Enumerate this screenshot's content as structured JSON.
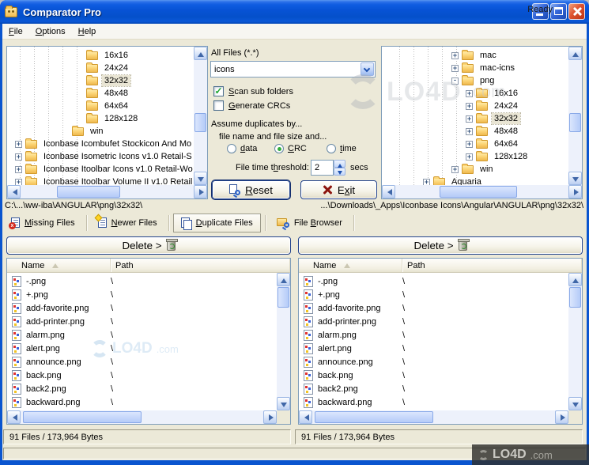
{
  "window": {
    "title": "Comparator Pro"
  },
  "colors": {
    "titlebar_blue": "#0752d4",
    "client_beige": "#ece9d8",
    "panel_border": "#7f9db9",
    "close_red": "#dd5330",
    "folder_yellow": "#fcd575",
    "check_green": "#1ba52f"
  },
  "menu": {
    "items": [
      {
        "pre": "",
        "key": "F",
        "post": "ile"
      },
      {
        "pre": "",
        "key": "O",
        "post": "ptions"
      },
      {
        "pre": "",
        "key": "H",
        "post": "elp"
      }
    ]
  },
  "filter": {
    "label": "All Files (*.*)",
    "value": "icons"
  },
  "options": {
    "scan_sub_folders": {
      "pre": "",
      "key": "S",
      "post": "can sub folders",
      "checked": true
    },
    "generate_crcs": {
      "pre": "",
      "key": "G",
      "post": "enerate CRCs",
      "checked": false
    }
  },
  "duplicates": {
    "heading": "Assume duplicates by...",
    "subheading": "file name and file size and...",
    "radio_data": {
      "pre": "",
      "key": "d",
      "post": "ata"
    },
    "radio_crc": {
      "pre": "",
      "key": "C",
      "post": "RC"
    },
    "radio_time": {
      "pre": "",
      "key": "t",
      "post": "ime"
    },
    "selected_radio": "CRC",
    "threshold": {
      "pre": "File time t",
      "key": "h",
      "post": "reshold:",
      "value": "2",
      "unit": "secs"
    }
  },
  "buttons": {
    "reset": {
      "pre": "",
      "key": "R",
      "post": "eset"
    },
    "exit": {
      "pre": "E",
      "key": "x",
      "post": "it"
    },
    "delete_left": "Delete >",
    "delete_right": "Delete >"
  },
  "left_tree": {
    "items": [
      {
        "label": "16x16"
      },
      {
        "label": "24x24"
      },
      {
        "label": "32x32",
        "selected": true
      },
      {
        "label": "48x48"
      },
      {
        "label": "64x64"
      },
      {
        "label": "128x128"
      },
      {
        "label": "win"
      },
      {
        "label": "Iconbase Icombufet Stockicon And Mo"
      },
      {
        "label": "Iconbase Isometric Icons v1.0 Retail-S"
      },
      {
        "label": "Iconbase Itoolbar Icons v1.0 Retail-Wo"
      },
      {
        "label": "Iconbase Itoolbar Volume II v1.0 Retail"
      }
    ]
  },
  "right_tree": {
    "items": [
      {
        "label": "mac"
      },
      {
        "label": "mac-icns"
      },
      {
        "label": "png"
      },
      {
        "label": "16x16"
      },
      {
        "label": "24x24"
      },
      {
        "label": "32x32",
        "selected": true
      },
      {
        "label": "48x48"
      },
      {
        "label": "64x64"
      },
      {
        "label": "128x128"
      },
      {
        "label": "win"
      },
      {
        "label": "Aquaria"
      }
    ]
  },
  "paths": {
    "left": "C:\\...\\ww-iba\\ANGULAR\\png\\32x32\\",
    "right": "...\\Downloads\\_Apps\\Iconbase Icons\\Angular\\ANGULAR\\png\\32x32\\"
  },
  "tabs": {
    "missing": {
      "pre": "",
      "key": "M",
      "post": "issing Files"
    },
    "newer": {
      "pre": "",
      "key": "N",
      "post": "ewer Files"
    },
    "duplicate": {
      "pre": "",
      "key": "D",
      "post": "uplicate Files",
      "selected": true
    },
    "browser": {
      "pre": "File ",
      "key": "B",
      "post": "rowser"
    }
  },
  "lists": {
    "columns": {
      "name": "Name",
      "path": "Path"
    },
    "rows": [
      {
        "name": "-.png",
        "path": "\\"
      },
      {
        "name": "+.png",
        "path": "\\"
      },
      {
        "name": "add-favorite.png",
        "path": "\\"
      },
      {
        "name": "add-printer.png",
        "path": "\\"
      },
      {
        "name": "alarm.png",
        "path": "\\"
      },
      {
        "name": "alert.png",
        "path": "\\"
      },
      {
        "name": "announce.png",
        "path": "\\"
      },
      {
        "name": "back.png",
        "path": "\\"
      },
      {
        "name": "back2.png",
        "path": "\\"
      },
      {
        "name": "backward.png",
        "path": "\\"
      }
    ]
  },
  "status": {
    "left": "91 Files  /  173,964 Bytes",
    "right": "91 Files  /  173,964 Bytes"
  },
  "watermark": {
    "name": "LO4D",
    "tld": ".com",
    "ready": "Ready"
  }
}
